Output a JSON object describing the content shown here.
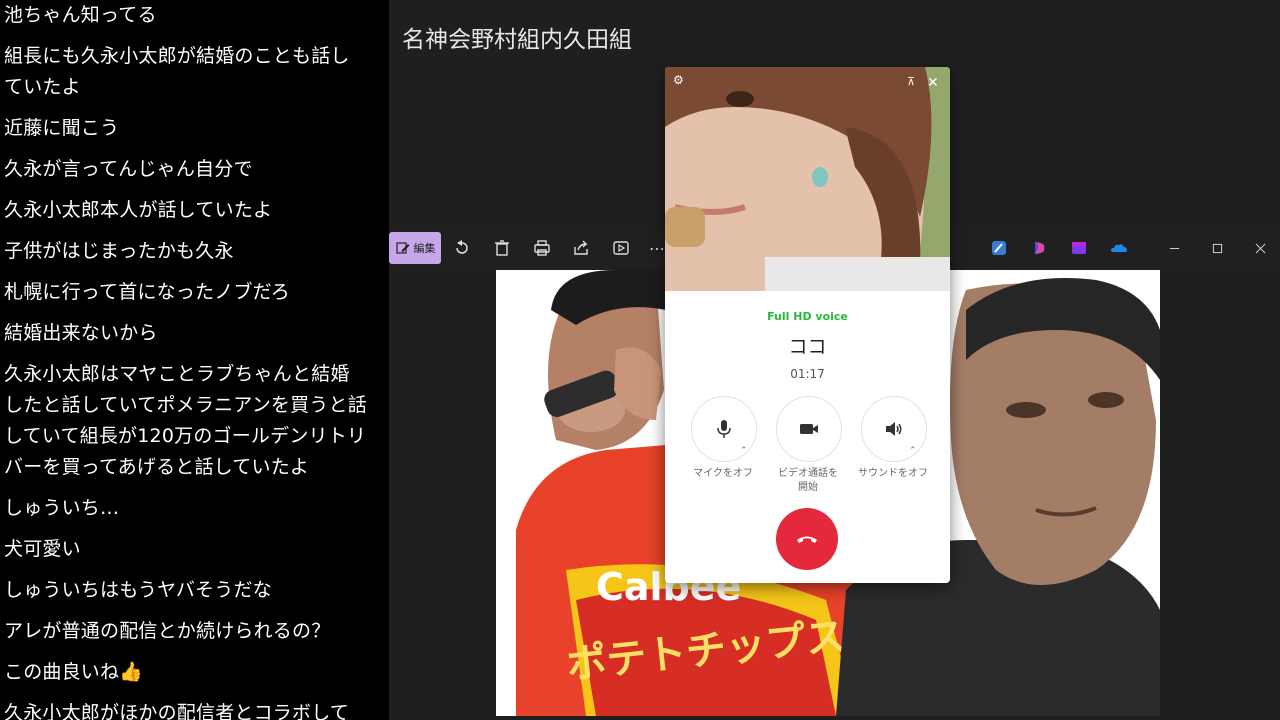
{
  "chat": {
    "messages": [
      "池ちゃん知ってる",
      "組長にも久永小太郎が結婚のことも話していたよ",
      "近藤に聞こう",
      "久永が言ってんじゃん自分で",
      "久永小太郎本人が話していたよ",
      "子供がはじまったかも久永",
      "札幌に行って首になったノブだろ",
      "結婚出来ないから",
      "久永小太郎はマヤことラブちゃんと結婚したと話していてポメラニアンを買うと話していて組長が120万のゴールデンリトリバーを買ってあげると話していたよ",
      "しゅういち…",
      "犬可愛い",
      "しゅういちはもうヤバそうだな",
      "アレが普通の配信とか続けられるの？",
      "この曲良いね👍",
      "久永小太郎がほかの配信者とコラボして"
    ]
  },
  "photo_title": "名神会野村組内久田組",
  "toolbar": {
    "edit_label": "編集"
  },
  "call": {
    "hd_voice": "Full HD voice",
    "caller_name": "ココ",
    "timer": "01:17",
    "mic_label": "マイクをオフ",
    "video_label": "ビデオ通話を開始",
    "sound_label": "サウンドをオフ",
    "end_call_color": "#e5283b"
  },
  "photo_text": {
    "bag_text_1": "Calbee",
    "bag_text_2": "ポテトチップス"
  }
}
